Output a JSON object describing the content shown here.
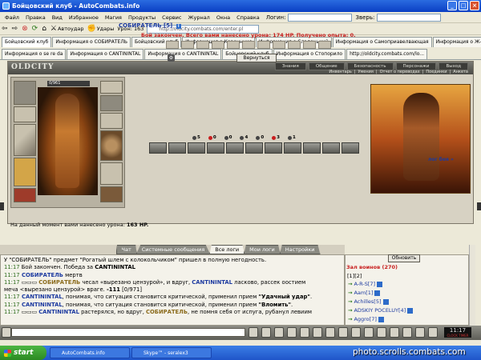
{
  "window": {
    "title": "Бойцовский клуб - AutoCombats.info",
    "btn_min": "_",
    "btn_max": "□",
    "btn_close": "×"
  },
  "menu": {
    "items": [
      "Файл",
      "Правка",
      "Вид",
      "Избранное",
      "Магия",
      "Продукты",
      "Сервис",
      "Журнал",
      "Окна",
      "Справка"
    ],
    "login_label": "Логин:",
    "beast_label": "Зверь:"
  },
  "toolbar": {
    "autoattack": "Автоудар",
    "hits": "Удары",
    "damage_label": "Урон: 163",
    "address": "http://oldcity.combats.com/enter.pl"
  },
  "tabs_row1": [
    "Бойцовский клуб",
    "Информация о СОБИРАТЕЛЬ",
    "Бойцовский клуб",
    "Информация о Коронннис",
    "Информация о Сладенький",
    "Информация о Самоприавелвающая",
    "Информация о Ж-нежная-Ж"
  ],
  "tabs_row2": [
    "Информация о se re da",
    "Информация о CANTININTAL",
    "Информация о CANTININTAL",
    "Бойцовский клуб",
    "Информация о Стопорило",
    "http://oldcity.combats.com/lo..."
  ],
  "game": {
    "logo": "OLDCITY",
    "topnav": [
      "Знания",
      "Общение",
      "Безопасность",
      "Персонажи",
      "Выход"
    ],
    "subnav": [
      "Инвентарь",
      "Умения",
      "Отчет о переводах",
      "Поединки",
      "Анкета"
    ],
    "hp": "0/961",
    "opponent_name": "СОБИРАТЕЛЬ",
    "opponent_level": "[5]",
    "info_icon": "i",
    "battle_message": "Бой закончен. Всего вами нанесено урона: 174 HP. Получено опыта: 0.",
    "back_button": "Вернуться",
    "stats": [
      {
        "icon": "sword",
        "value": "5",
        "color": "#444444"
      },
      {
        "icon": "drop",
        "value": "0",
        "color": "#c81e1e"
      },
      {
        "icon": "skull",
        "value": "0",
        "color": "#444444"
      },
      {
        "icon": "armor",
        "value": "4",
        "color": "#444444"
      },
      {
        "icon": "shield",
        "value": "0",
        "color": "#444444"
      },
      {
        "icon": "heart",
        "value": "3",
        "color": "#c81e1e"
      },
      {
        "icon": "spirit",
        "value": "1",
        "color": "#444444"
      }
    ],
    "battle_log_link": "лог боя »",
    "damage_prefix": "На данный момент вами нанесено урона: ",
    "damage_value": "163 HP."
  },
  "chat_tabs": [
    "Чат",
    "Системные сообщения",
    "Все логи",
    "Мои логи",
    "Настройки"
  ],
  "chat_active_tab": "Все логи",
  "chat_lines": [
    {
      "time": "",
      "parts": [
        {
          "t": "У \"СОБИРАТЕЛЬ\" предмет \"Рогатый шлем с колокольчиком\" пришел в полную негодность.",
          "c": ""
        }
      ]
    },
    {
      "time": "11:17",
      "parts": [
        {
          "t": " Бой закончен. Победа за ",
          "c": ""
        },
        {
          "t": "CANTININTAL",
          "c": "blk"
        }
      ]
    },
    {
      "time": "11:17",
      "parts": [
        {
          "t": " СОБИРАТЕЛЬ",
          "c": "can"
        },
        {
          "t": " мертв",
          "c": ""
        }
      ]
    },
    {
      "time": "11:17",
      "parts": [
        {
          "t": " ▭▭▭ ",
          "c": ""
        },
        {
          "t": "СОБИРАТЕЛЬ",
          "c": "sob"
        },
        {
          "t": " чесал «вырезано цензурой», и вдруг, ",
          "c": ""
        },
        {
          "t": "CANTININTAL",
          "c": "can"
        },
        {
          "t": " ласково, рассек оостием",
          "c": ""
        }
      ]
    },
    {
      "time": "",
      "parts": [
        {
          "t": "меча <вырезано цензурой> враге. ",
          "c": ""
        },
        {
          "t": "-111",
          "c": "blk"
        },
        {
          "t": " [0/971]",
          "c": ""
        }
      ]
    },
    {
      "time": "11:17",
      "parts": [
        {
          "t": " CANTININTAL",
          "c": "can"
        },
        {
          "t": ", понимая, что ситуация становится критической, применил прием ",
          "c": ""
        },
        {
          "t": "\"Удачный удар\"",
          "c": "blk"
        },
        {
          "t": ".",
          "c": ""
        }
      ]
    },
    {
      "time": "11:17",
      "parts": [
        {
          "t": " CANTININTAL",
          "c": "can"
        },
        {
          "t": ", понимая, что ситуация становится критической, применил прием ",
          "c": ""
        },
        {
          "t": "\"Вломить\"",
          "c": "blk"
        },
        {
          "t": ".",
          "c": ""
        }
      ]
    },
    {
      "time": "11:17",
      "parts": [
        {
          "t": " ▭▭▭ ",
          "c": ""
        },
        {
          "t": "CANTININTAL",
          "c": "can"
        },
        {
          "t": " растерялся, но вдруг, ",
          "c": ""
        },
        {
          "t": "СОБИРАТЕЛЬ",
          "c": "sob"
        },
        {
          "t": ", не помня себя от испуга, рубанул левиим",
          "c": ""
        }
      ]
    }
  ],
  "room": {
    "update_button": "Обновить",
    "title": "Зал воинов (270)",
    "pages": "[1][2]",
    "players": [
      "A-R-S[7]",
      "Aam[1]",
      "Achilles[5]",
      "ADSKIY POCELUY[4]",
      "Aggro[7]"
    ]
  },
  "clock": {
    "time": "11:17",
    "sub": "CLOCK TIMER"
  },
  "taskbar": {
    "start": "start",
    "tasks": [
      "AutoCombats.info",
      "Skype™ - seralex3"
    ],
    "watermark": "photo.scrolls.combats.com"
  }
}
